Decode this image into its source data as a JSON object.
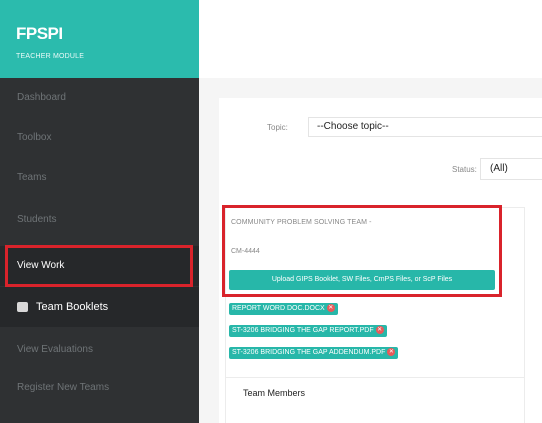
{
  "brand": {
    "title": "FPSPI",
    "subtitle": "TEACHER MODULE"
  },
  "sidebar": {
    "items": [
      {
        "label": "Dashboard"
      },
      {
        "label": "Toolbox"
      },
      {
        "label": "Teams"
      },
      {
        "label": "Students"
      },
      {
        "label": "View Work"
      },
      {
        "label": "Team Booklets"
      },
      {
        "label": "View Evaluations"
      },
      {
        "label": "Register New Teams"
      }
    ]
  },
  "filters": {
    "topic_label": "Topic:",
    "topic_value": "--Choose topic--",
    "status_label": "Status:",
    "status_value": "(All)"
  },
  "team": {
    "title": "COMMUNITY PROBLEM SOLVING TEAM -",
    "code": "CM-4444",
    "upload_label": "Upload GIPS Booklet, SW Files, CmPS Files, or ScP Files",
    "files": [
      "REPORT WORD DOC.DOCX",
      "ST-3206 BRIDGING THE GAP REPORT.PDF",
      "ST-3206 BRIDGING THE GAP ADDENDUM.PDF"
    ],
    "members_label": "Team Members"
  },
  "colors": {
    "accent": "#2bbbad",
    "sidebar": "#2f3133",
    "highlight": "#d9232b",
    "remove": "#e85a5a"
  }
}
